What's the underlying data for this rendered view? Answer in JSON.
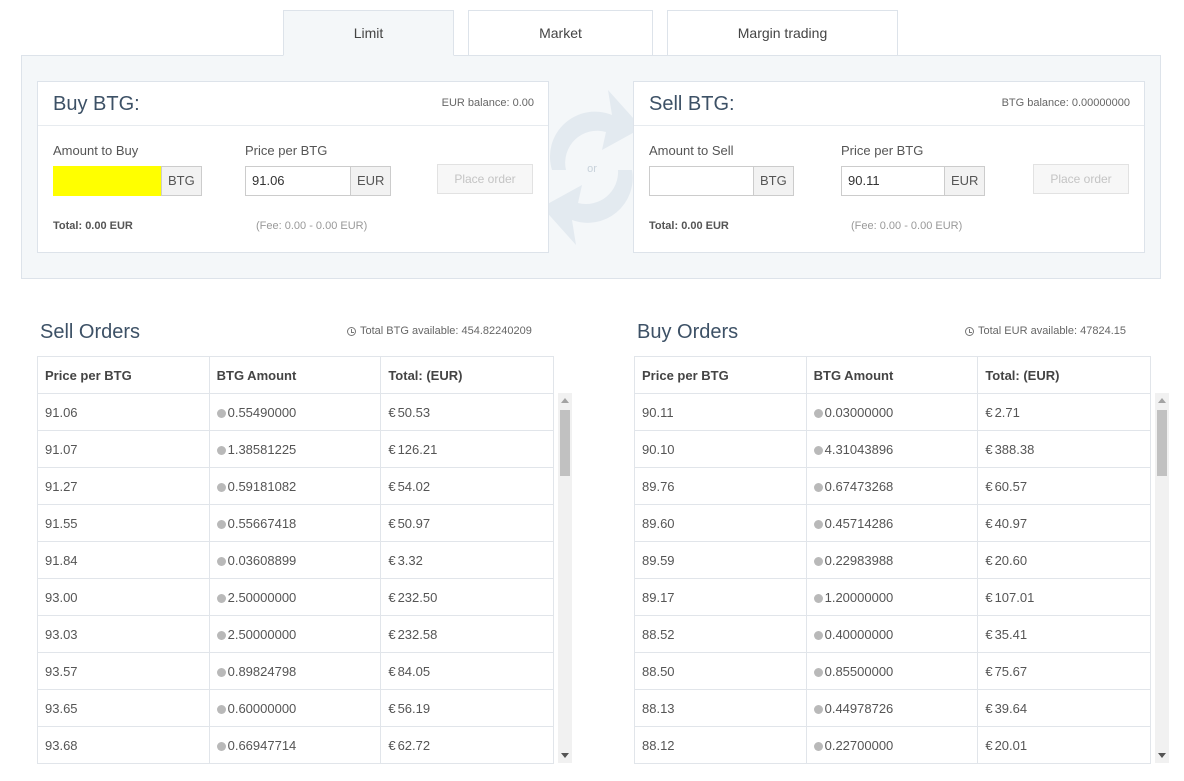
{
  "tabs": [
    {
      "label": "Limit",
      "active": true
    },
    {
      "label": "Market",
      "active": false
    },
    {
      "label": "Margin trading",
      "active": false
    }
  ],
  "buy": {
    "title": "Buy BTG:",
    "balance": "EUR balance: 0.00",
    "amount_label": "Amount to Buy",
    "amount_value": "",
    "amount_unit": "BTG",
    "price_label": "Price per BTG",
    "price_value": "91.06",
    "price_unit": "EUR",
    "button": "Place order",
    "total_label": "Total:",
    "total_value": "0.00 EUR",
    "fee": "(Fee: 0.00 - 0.00 EUR)"
  },
  "swap": {
    "label": "or"
  },
  "sell": {
    "title": "Sell BTG:",
    "balance": "BTG balance: 0.00000000",
    "amount_label": "Amount to Sell",
    "amount_value": "",
    "amount_unit": "BTG",
    "price_label": "Price per BTG",
    "price_value": "90.11",
    "price_unit": "EUR",
    "button": "Place order",
    "total_label": "Total:",
    "total_value": "0.00 EUR",
    "fee": "(Fee: 0.00 - 0.00 EUR)"
  },
  "sell_orders": {
    "title": "Sell Orders",
    "info": "Total BTG available: 454.82240209",
    "headers": [
      "Price per BTG",
      "BTG Amount",
      "Total: (EUR)"
    ],
    "rows": [
      [
        "91.06",
        "0.55490000",
        "50.53"
      ],
      [
        "91.07",
        "1.38581225",
        "126.21"
      ],
      [
        "91.27",
        "0.59181082",
        "54.02"
      ],
      [
        "91.55",
        "0.55667418",
        "50.97"
      ],
      [
        "91.84",
        "0.03608899",
        "3.32"
      ],
      [
        "93.00",
        "2.50000000",
        "232.50"
      ],
      [
        "93.03",
        "2.50000000",
        "232.58"
      ],
      [
        "93.57",
        "0.89824798",
        "84.05"
      ],
      [
        "93.65",
        "0.60000000",
        "56.19"
      ],
      [
        "93.68",
        "0.66947714",
        "62.72"
      ]
    ]
  },
  "buy_orders": {
    "title": "Buy Orders",
    "info": "Total EUR available: 47824.15",
    "headers": [
      "Price per BTG",
      "BTG Amount",
      "Total: (EUR)"
    ],
    "rows": [
      [
        "90.11",
        "0.03000000",
        "2.71"
      ],
      [
        "90.10",
        "4.31043896",
        "388.38"
      ],
      [
        "89.76",
        "0.67473268",
        "60.57"
      ],
      [
        "89.60",
        "0.45714286",
        "40.97"
      ],
      [
        "89.59",
        "0.22983988",
        "20.60"
      ],
      [
        "89.17",
        "1.20000000",
        "107.01"
      ],
      [
        "88.52",
        "0.40000000",
        "35.41"
      ],
      [
        "88.50",
        "0.85500000",
        "75.67"
      ],
      [
        "88.13",
        "0.44978726",
        "39.64"
      ],
      [
        "88.12",
        "0.22700000",
        "20.01"
      ]
    ]
  },
  "currency_symbol": "€",
  "colors": {
    "accent_title": "#3d5166",
    "highlight": "#ffff00",
    "panel_bg": "#f4f7f9"
  }
}
